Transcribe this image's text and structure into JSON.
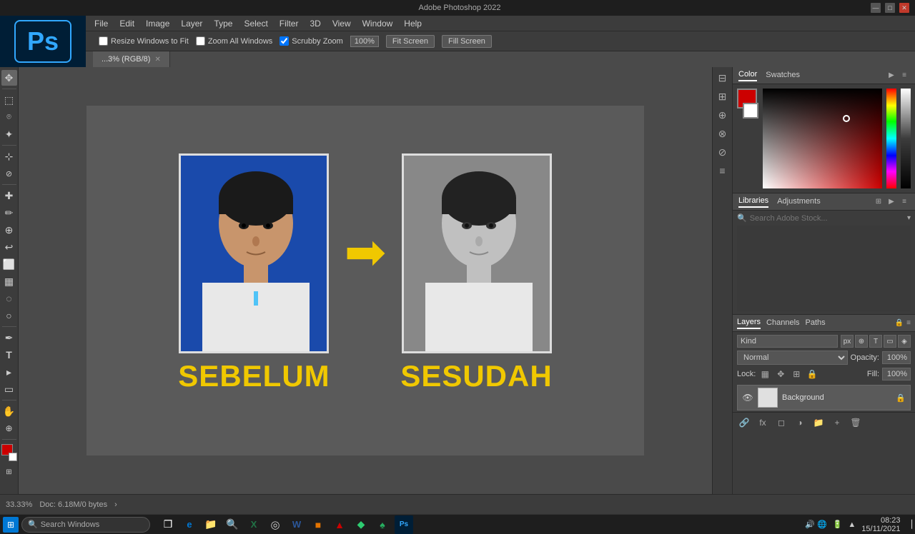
{
  "titlebar": {
    "title": "Adobe Photoshop 2022",
    "minimize": "—",
    "maximize": "□",
    "close": "✕"
  },
  "menubar": {
    "items": [
      "File",
      "Edit",
      "Image",
      "Layer",
      "Type",
      "Select",
      "Filter",
      "3D",
      "View",
      "Window",
      "Help"
    ]
  },
  "optionsbar": {
    "resize_windows": "Resize Windows to Fit",
    "zoom_all": "Zoom All Windows",
    "scrubby_zoom": "Scrubby Zoom",
    "zoom_value": "100%",
    "fit_screen": "Fit Screen",
    "fill_screen": "Fill Screen"
  },
  "tabbar": {
    "tab_name": "...3% (RGB/8)",
    "close": "✕"
  },
  "canvas": {
    "before_label": "SEBELUM",
    "after_label": "SESUDAH",
    "arrow": "➡"
  },
  "tools": {
    "items": [
      {
        "name": "move",
        "icon": "✥"
      },
      {
        "name": "marquee",
        "icon": "⬚"
      },
      {
        "name": "lasso",
        "icon": "⌾"
      },
      {
        "name": "magic-wand",
        "icon": "⋆"
      },
      {
        "name": "crop",
        "icon": "⊹"
      },
      {
        "name": "eyedropper",
        "icon": "⊘"
      },
      {
        "name": "spot-healing",
        "icon": "✚"
      },
      {
        "name": "brush",
        "icon": "✏"
      },
      {
        "name": "clone-stamp",
        "icon": "⊕"
      },
      {
        "name": "history-brush",
        "icon": "↩"
      },
      {
        "name": "eraser",
        "icon": "⬜"
      },
      {
        "name": "gradient",
        "icon": "▦"
      },
      {
        "name": "blur",
        "icon": "◌"
      },
      {
        "name": "dodge",
        "icon": "○"
      },
      {
        "name": "pen",
        "icon": "✒"
      },
      {
        "name": "text",
        "icon": "T"
      },
      {
        "name": "path-select",
        "icon": "▸"
      },
      {
        "name": "shape",
        "icon": "□"
      },
      {
        "name": "hand",
        "icon": "✋"
      },
      {
        "name": "zoom",
        "icon": "🔍"
      },
      {
        "name": "fg-color",
        "icon": "■"
      },
      {
        "name": "extra",
        "icon": "⊞"
      }
    ]
  },
  "color_panel": {
    "tab_color": "Color",
    "tab_swatches": "Swatches",
    "fg_color": "#cc0000",
    "bg_color": "#ffffff"
  },
  "libraries_panel": {
    "tab_libraries": "Libraries",
    "tab_adjustments": "Adjustments",
    "search_placeholder": "Search Adobe Stock..."
  },
  "layers_panel": {
    "tab_layers": "Layers",
    "tab_channels": "Channels",
    "tab_paths": "Paths",
    "filter_placeholder": "Kind",
    "blend_mode": "Normal",
    "opacity_label": "Opacity:",
    "opacity_value": "100%",
    "lock_label": "Lock:",
    "fill_label": "Fill:",
    "fill_value": "100%",
    "layers": [
      {
        "name": "Background",
        "visible": true,
        "locked": true,
        "thumb_color": "#e0e0e0"
      }
    ]
  },
  "statusbar": {
    "zoom": "33.33%",
    "doc_info": "Doc: 6.18M/0 bytes",
    "arrow": "›"
  },
  "taskbar": {
    "search_placeholder": "Search Windows",
    "time": "08:23",
    "date": "15/11/2021",
    "apps": [
      {
        "name": "windows",
        "icon": "⊞",
        "color": "#0078d4"
      },
      {
        "name": "task-view",
        "icon": "❒",
        "color": "#ffffff"
      },
      {
        "name": "edge",
        "icon": "e",
        "color": "#0078d4"
      },
      {
        "name": "file-explorer",
        "icon": "📁",
        "color": "#f0c800"
      },
      {
        "name": "search",
        "icon": "🔍",
        "color": "#ffffff"
      },
      {
        "name": "excel",
        "icon": "X",
        "color": "#217346"
      },
      {
        "name": "chrome",
        "icon": "◎",
        "color": "#4285f4"
      },
      {
        "name": "word",
        "icon": "W",
        "color": "#2b579a"
      },
      {
        "name": "app1",
        "icon": "■",
        "color": "#e37400"
      },
      {
        "name": "app2",
        "icon": "▲",
        "color": "#cc0000"
      },
      {
        "name": "app3",
        "icon": "◆",
        "color": "#2ecc71"
      },
      {
        "name": "app4",
        "icon": "♠",
        "color": "#27ae60"
      },
      {
        "name": "photoshop-tb",
        "icon": "Ps",
        "color": "#31a8ff"
      }
    ],
    "tray": [
      "🔊",
      "🌐",
      "🔋"
    ]
  }
}
